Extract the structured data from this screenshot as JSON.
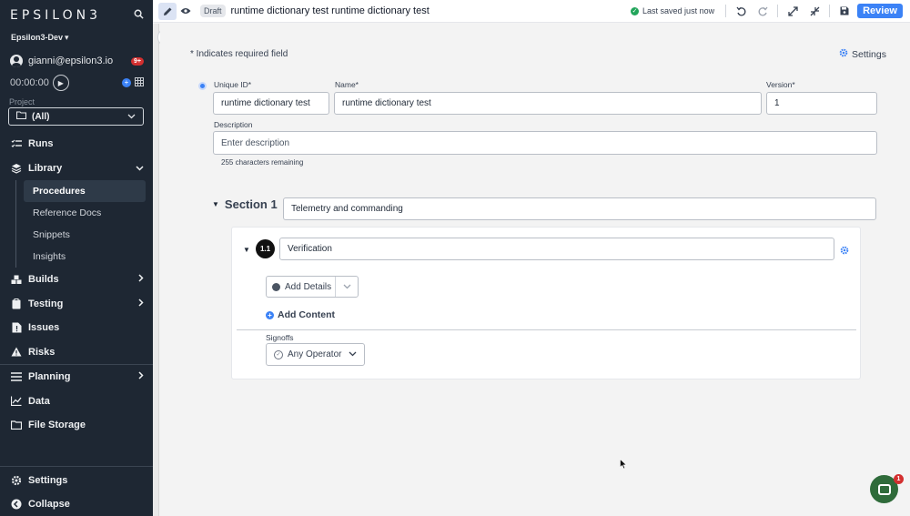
{
  "sidebar": {
    "logo": "EPSILON3",
    "workspace": "Epsilon3-Dev",
    "user_email": "gianni@epsilon3.io",
    "notifications": "9+",
    "timer": "00:00:00",
    "project_label": "Project",
    "project_value": "(All)",
    "nav": [
      {
        "label": "Runs",
        "icon": "runs-icon"
      },
      {
        "label": "Library",
        "icon": "layers-icon",
        "expanded": true
      },
      {
        "label": "Builds",
        "icon": "cubes-icon"
      },
      {
        "label": "Testing",
        "icon": "clipboard-icon"
      },
      {
        "label": "Issues",
        "icon": "issue-icon"
      },
      {
        "label": "Risks",
        "icon": "warning-icon"
      },
      {
        "label": "Planning",
        "icon": "bars-icon"
      },
      {
        "label": "Data",
        "icon": "chart-icon"
      },
      {
        "label": "File Storage",
        "icon": "folder-icon"
      }
    ],
    "library_items": [
      "Procedures",
      "Reference Docs",
      "Snippets",
      "Insights"
    ],
    "bottom": {
      "settings": "Settings",
      "collapse": "Collapse"
    }
  },
  "topbar": {
    "status_badge": "Draft",
    "title": "runtime dictionary test runtime dictionary test",
    "saved_text": "Last saved just now",
    "review_label": "Review"
  },
  "form": {
    "required_note": "* Indicates required field",
    "settings_label": "Settings",
    "unique_id_label": "Unique ID*",
    "unique_id_value": "runtime dictionary test",
    "name_label": "Name*",
    "name_value": "runtime dictionary test",
    "version_label": "Version*",
    "version_value": "1",
    "description_label": "Description",
    "description_placeholder": "Enter description",
    "chars_remaining": "255 characters remaining"
  },
  "section": {
    "title": "Section 1",
    "name_value": "Telemetry and commanding",
    "step": {
      "number": "1.1",
      "name_value": "Verification",
      "add_details_label": "Add Details",
      "add_content_label": "Add Content",
      "signoffs_label": "Signoffs",
      "operator_value": "Any Operator"
    }
  },
  "chat": {
    "badge": "1"
  },
  "colors": {
    "accent": "#3b82f6",
    "sidebar_bg": "#1e2733",
    "success": "#22a55b",
    "danger": "#d32f2f"
  }
}
